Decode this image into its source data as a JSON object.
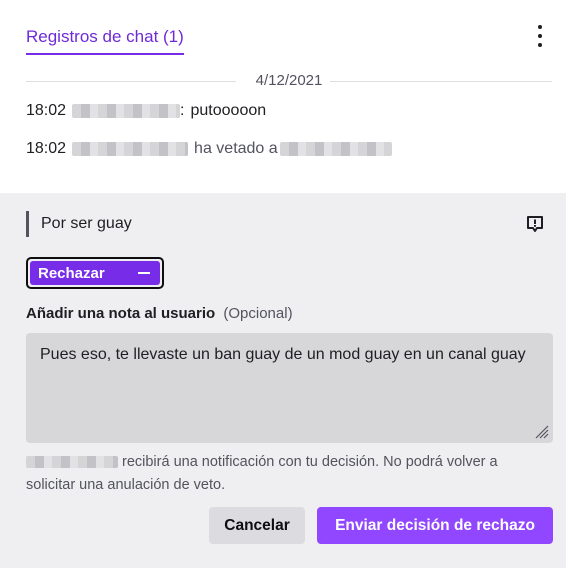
{
  "tabs": {
    "chat_logs": "Registros de chat (1)"
  },
  "log": {
    "date": "4/12/2021",
    "lines": [
      {
        "time": "18:02",
        "separator": ":",
        "message": "putooooon"
      },
      {
        "time": "18:02",
        "message": "ha vetado a"
      }
    ]
  },
  "ban": {
    "reason": "Por ser guay"
  },
  "decision": {
    "reject_label": "Rechazar"
  },
  "note": {
    "label": "Añadir una nota al usuario",
    "optional": "(Opcional)",
    "value": "Pues eso, te llevaste un ban guay de un mod guay en un canal guay"
  },
  "notice_text": "recibirá una notificación con tu decisión. No podrá volver a solicitar una anulación de veto.",
  "actions": {
    "cancel": "Cancelar",
    "send": "Enviar decisión de rechazo"
  },
  "colors": {
    "accent": "#772ce8",
    "primary_button": "#9147ff",
    "panel_bg": "#efeff1"
  }
}
